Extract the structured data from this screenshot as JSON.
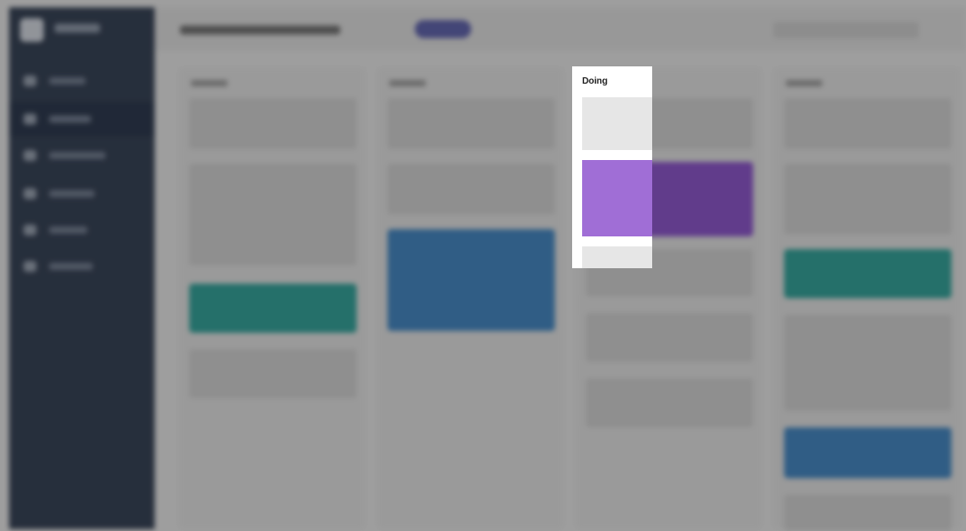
{
  "focus_column": {
    "title": "Doing"
  },
  "colors": {
    "sidebar": "#2d3a4f",
    "teal_card": "#2aa39a",
    "blue_card": "#3d85c5",
    "purple_card": "#a06ed6",
    "grey_card": "#e6e6e6"
  },
  "icons": {
    "sidebar_items": [
      "home-icon",
      "projects-icon",
      "messages-icon",
      "calendar-icon",
      "reports-icon",
      "settings-icon"
    ]
  }
}
